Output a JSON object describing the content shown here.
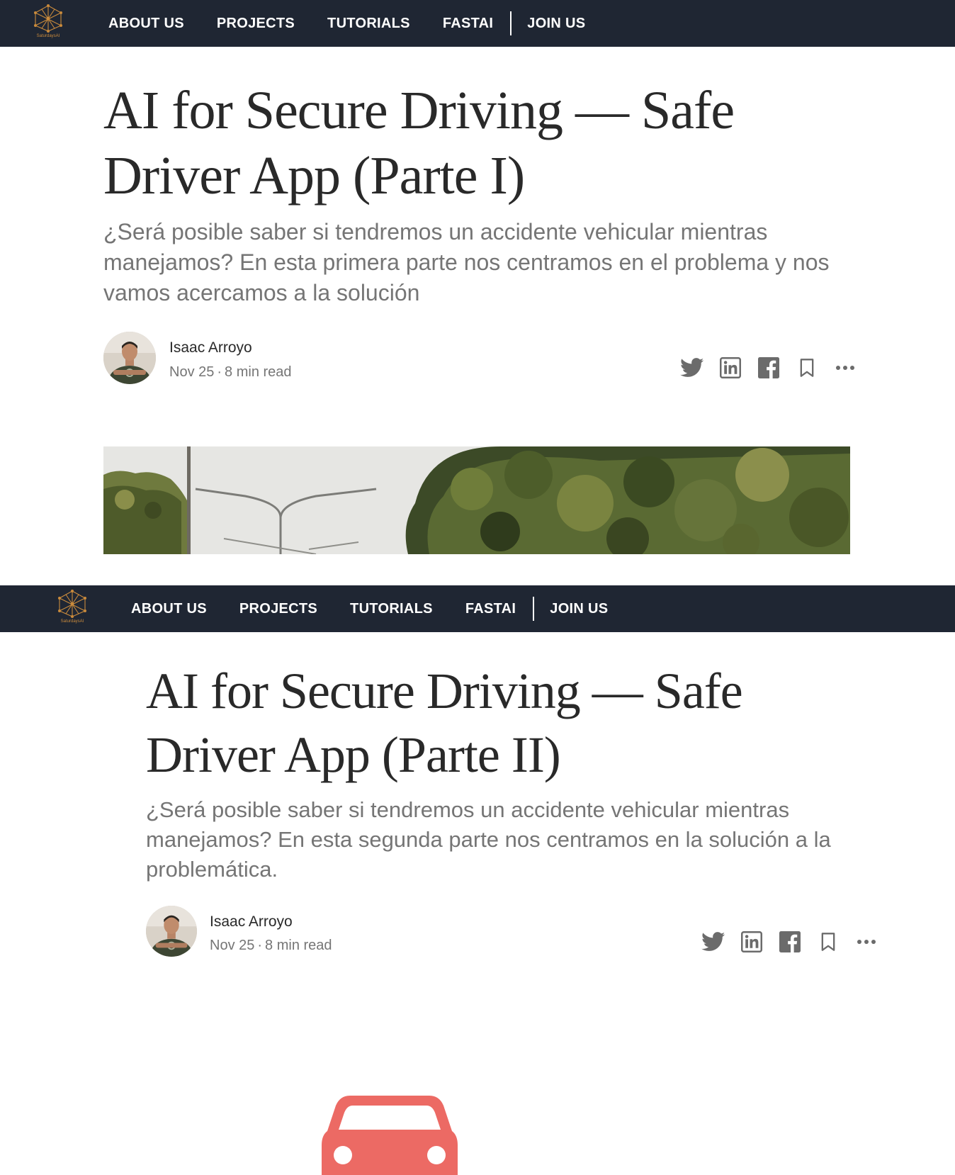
{
  "nav": {
    "logo_text": "SaturdaysAI",
    "links": [
      "ABOUT US",
      "PROJECTS",
      "TUTORIALS",
      "FASTAI"
    ],
    "join": "JOIN US"
  },
  "articles": [
    {
      "title": "AI for Secure Driving — Safe Driver App (Parte I)",
      "subtitle": "¿Será posible saber si tendremos un accidente vehicular mientras manejamos? En esta primera parte nos centramos en el problema y nos vamos acercamos a la solución",
      "author": "Isaac Arroyo",
      "date": "Nov 25",
      "separator": "·",
      "read_time": "8 min read"
    },
    {
      "title": "AI for Secure Driving — Safe Driver App (Parte II)",
      "subtitle": "¿Será posible saber si tendremos un accidente vehicular mientras manejamos? En esta segunda parte nos centramos en la solución a la problemática.",
      "author": "Isaac Arroyo",
      "date": "Nov 25",
      "separator": "·",
      "read_time": "8 min read"
    }
  ],
  "share_icons": [
    "twitter-icon",
    "linkedin-icon",
    "facebook-icon",
    "bookmark-icon",
    "more-icon"
  ],
  "colors": {
    "navbar_bg": "#1f2633",
    "nav_text": "#ffffff",
    "title_text": "#292929",
    "subtitle_text": "#757575",
    "icon_gray": "#6b6b6b",
    "logo_gold": "#c98a3c",
    "car_red": "#ec6a64"
  }
}
